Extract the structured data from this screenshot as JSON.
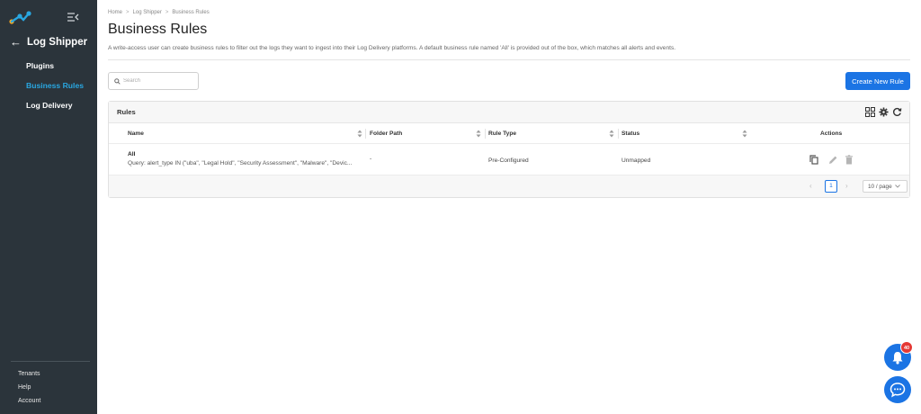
{
  "sidebar": {
    "back_title": "Log Shipper",
    "items": [
      {
        "label": "Plugins",
        "active": false
      },
      {
        "label": "Business Rules",
        "active": true
      },
      {
        "label": "Log Delivery",
        "active": false
      }
    ],
    "footer": [
      "Tenants",
      "Help",
      "Account"
    ]
  },
  "breadcrumb": [
    "Home",
    "Log Shipper",
    "Business Rules"
  ],
  "page": {
    "title": "Business Rules",
    "description": "A write-access user can create business rules to filter out the logs they want to ingest into their Log Delivery platforms. A default business rule named 'All' is provided out of the box, which matches all alerts and events."
  },
  "search": {
    "placeholder": "Search",
    "value": ""
  },
  "create_button": "Create New Rule",
  "card": {
    "title": "Rules",
    "columns": {
      "name": "Name",
      "folder_path": "Folder Path",
      "rule_type": "Rule Type",
      "status": "Status",
      "actions": "Actions"
    },
    "rows": [
      {
        "name": "All",
        "query": "Query: alert_type IN (\"uba\", \"Legal Hold\", \"Security Assessment\", \"Malware\", \"Devic...",
        "folder_path": "-",
        "rule_type": "Pre-Configured",
        "status": "Unmapped"
      }
    ]
  },
  "pagination": {
    "current_page": "1",
    "page_size": "10 / page"
  },
  "notifications": {
    "count": "40"
  },
  "colors": {
    "sidebar_bg": "#2b343b",
    "accent": "#29a7e1",
    "primary": "#1b74e4",
    "badge": "#e53935"
  },
  "icons": [
    "logo-icon",
    "collapse-menu-icon",
    "back-arrow-icon",
    "search-icon",
    "grid-icon",
    "gear-icon",
    "refresh-icon",
    "copy-icon",
    "edit-icon",
    "delete-icon",
    "bell-icon",
    "chat-icon",
    "chevron-down-icon"
  ]
}
